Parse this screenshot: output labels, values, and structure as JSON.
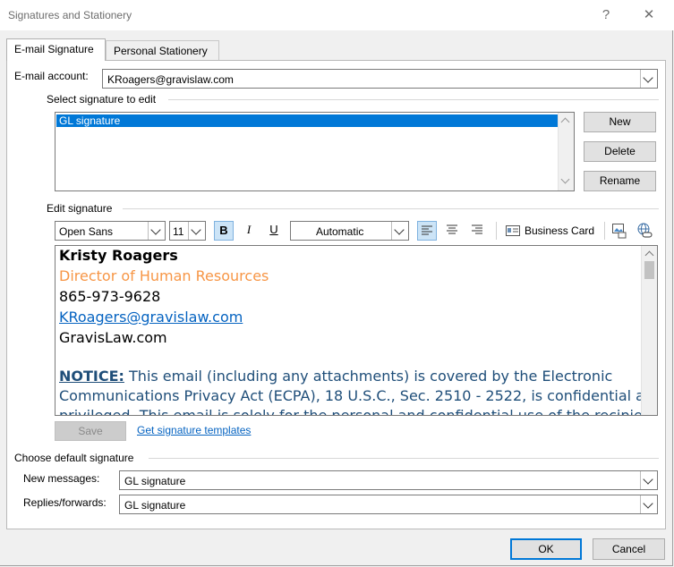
{
  "window": {
    "title": "Signatures and Stationery",
    "help_glyph": "?",
    "close_glyph": "✕"
  },
  "tabs": [
    {
      "label": "E-mail Signature",
      "active": true
    },
    {
      "label": "Personal Stationery",
      "active": false
    }
  ],
  "account": {
    "label": "E-mail account:",
    "value": "KRoagers@gravislaw.com"
  },
  "select_section": {
    "label": "Select signature to edit",
    "items": [
      "GL signature"
    ],
    "selected": "GL signature",
    "buttons": {
      "new": "New",
      "delete": "Delete",
      "rename": "Rename"
    }
  },
  "edit_section": {
    "label": "Edit signature",
    "font": "Open Sans",
    "size": "11",
    "bold": "B",
    "italic": "I",
    "underline": "U",
    "color": "Automatic",
    "business_card": "Business Card",
    "signature": {
      "name": "Kristy Roagers",
      "title": "Director of Human Resources",
      "phone": "865-973-9628",
      "email": "KRoagers@gravislaw.com",
      "website": "GravisLaw.com",
      "notice_label": "NOTICE:",
      "notice_line1": " This email (including any attachments) is covered by the Electronic",
      "notice_line2": "Communications Privacy Act (ECPA), 18 U.S.C., Sec. 2510 - 2522, is confidential and",
      "notice_line3": "privileged. This email is solely for the personal and confidential use of the recipient(s)"
    },
    "title_color": "#f79646",
    "notice_color": "#1f4e79",
    "save_label": "Save",
    "templates_link": "Get signature templates"
  },
  "default_section": {
    "label": "Choose default signature",
    "new_messages_label": "New messages:",
    "new_messages_value": "GL signature",
    "replies_label": "Replies/forwards:",
    "replies_value": "GL signature"
  },
  "footer": {
    "ok": "OK",
    "cancel": "Cancel"
  },
  "colors": {
    "accent": "#0078d7",
    "selection": "#0078d7"
  }
}
